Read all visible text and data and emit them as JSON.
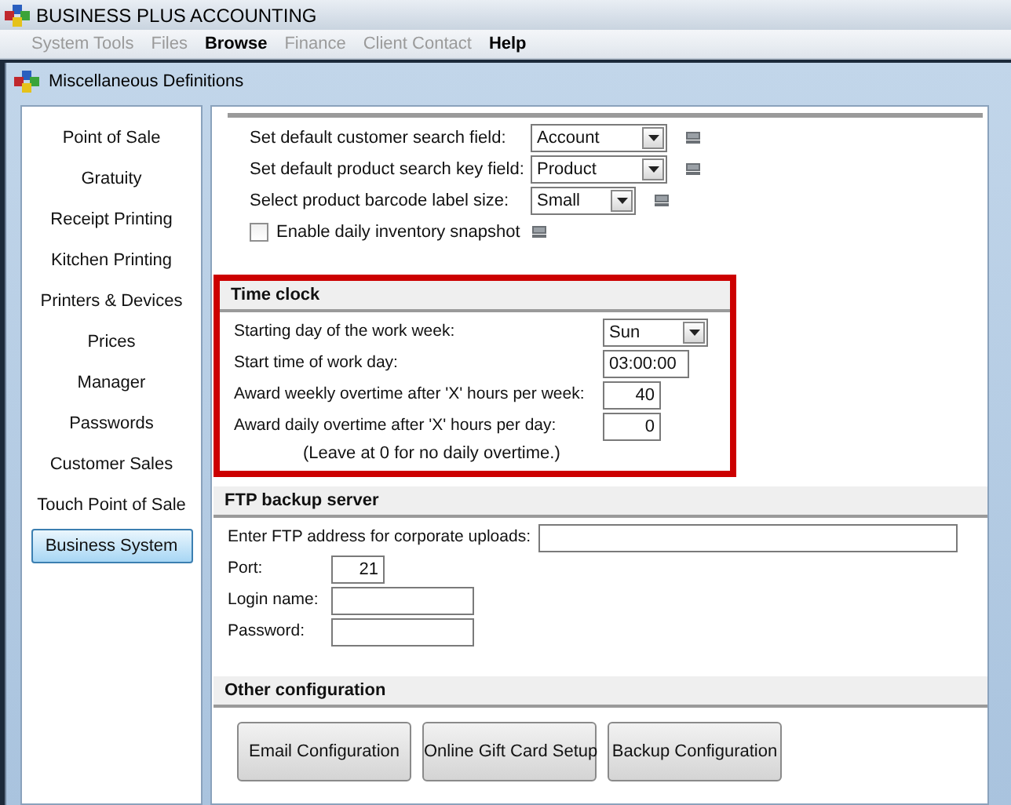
{
  "window": {
    "title": "BUSINESS PLUS ACCOUNTING"
  },
  "menu": [
    {
      "label": "System Tools",
      "disabled": true
    },
    {
      "label": "Files",
      "disabled": true
    },
    {
      "label": "Browse",
      "disabled": false
    },
    {
      "label": "Finance",
      "disabled": true
    },
    {
      "label": "Client Contact",
      "disabled": true
    },
    {
      "label": "Help",
      "disabled": false
    }
  ],
  "subwindow": {
    "title": "Miscellaneous Definitions"
  },
  "sidebar": {
    "items": [
      {
        "label": "Point of Sale",
        "selected": false
      },
      {
        "label": "Gratuity",
        "selected": false
      },
      {
        "label": "Receipt Printing",
        "selected": false
      },
      {
        "label": "Kitchen Printing",
        "selected": false
      },
      {
        "label": "Printers & Devices",
        "selected": false
      },
      {
        "label": "Prices",
        "selected": false
      },
      {
        "label": "Manager",
        "selected": false
      },
      {
        "label": "Passwords",
        "selected": false
      },
      {
        "label": "Customer Sales",
        "selected": false
      },
      {
        "label": "Touch Point of Sale",
        "selected": false
      },
      {
        "label": "Business System",
        "selected": true
      }
    ]
  },
  "general": [
    {
      "kind": "select",
      "label": "Set default customer search field:",
      "value": "Account"
    },
    {
      "kind": "select",
      "label": "Set default product search key field:",
      "value": "Product"
    },
    {
      "kind": "select_small",
      "label": "Select product barcode label size:",
      "value": "Small"
    },
    {
      "kind": "checkbox",
      "label": "Enable daily inventory snapshot",
      "checked": false
    }
  ],
  "sections": [
    {
      "title": "Time clock",
      "highlighted": true,
      "rows": [
        {
          "kind": "select",
          "label": "Starting day of the work week:",
          "value": "Sun"
        },
        {
          "kind": "time",
          "label": "Start time of work day:",
          "value": "03:00:00"
        },
        {
          "kind": "number",
          "label": "Award weekly overtime after 'X' hours per week:",
          "value": "40"
        },
        {
          "kind": "number",
          "label": "Award daily overtime after 'X' hours per day:",
          "value": "0"
        },
        {
          "kind": "note",
          "label": "(Leave at 0 for no daily overtime.)"
        }
      ]
    },
    {
      "title": "FTP backup server",
      "highlighted": false,
      "rows": [
        {
          "kind": "address",
          "label": "Enter FTP address for corporate uploads:"
        },
        {
          "kind": "port",
          "label": "Port:",
          "value": "21"
        },
        {
          "kind": "text",
          "label": "Login name:"
        },
        {
          "kind": "text",
          "label": "Password:"
        }
      ]
    },
    {
      "title": "Other configuration",
      "highlighted": false,
      "buttons": [
        "Email Configuration",
        "Online Gift Card Setup",
        "Backup Configuration"
      ]
    }
  ]
}
